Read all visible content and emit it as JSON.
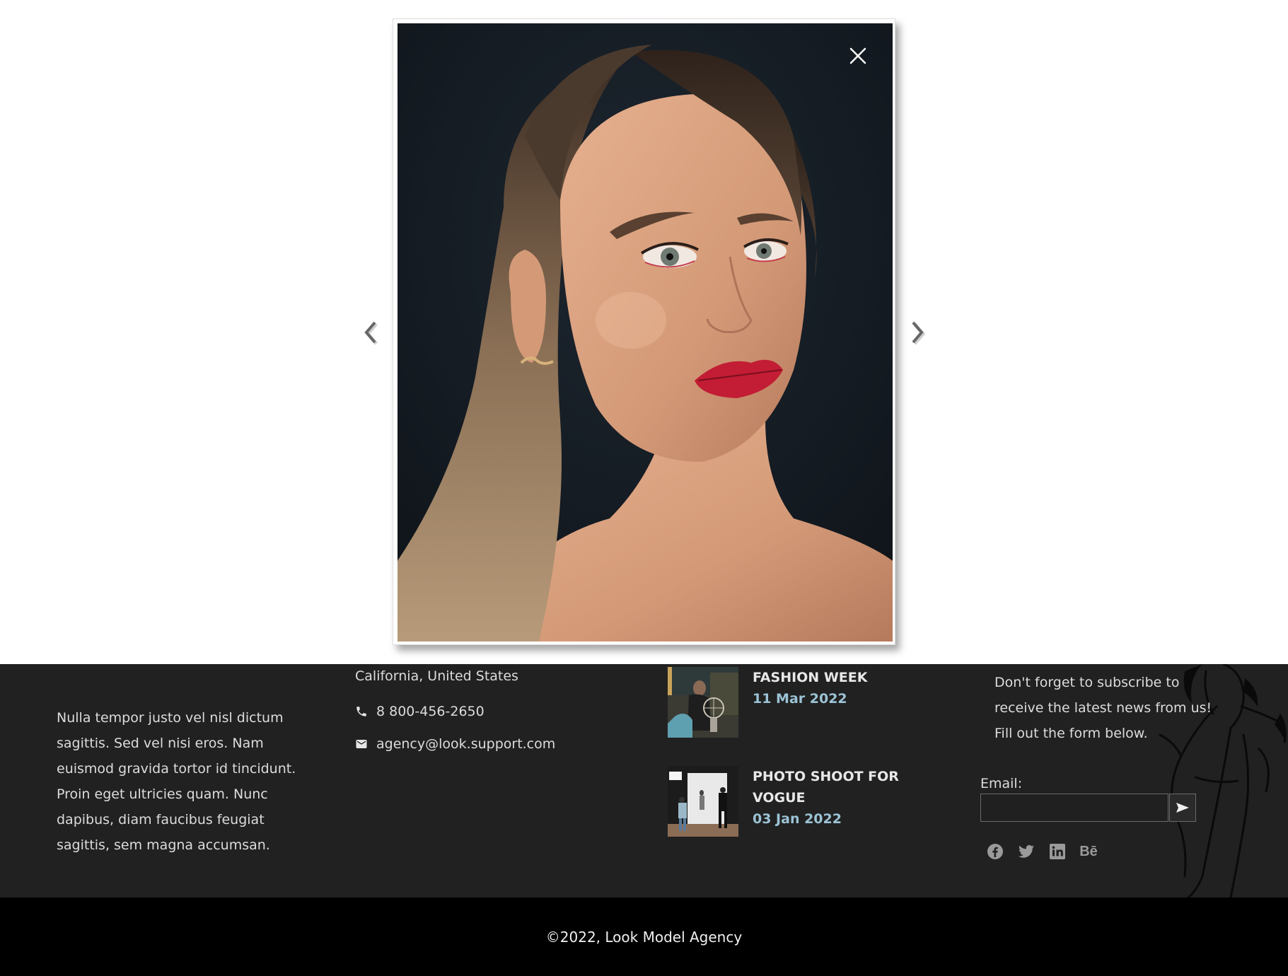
{
  "lightbox": {
    "close_icon": "close-icon",
    "prev_icon": "chevron-left-icon",
    "next_icon": "chevron-right-icon"
  },
  "footer": {
    "about_text": "Nulla tempor justo vel nisl dictum sagittis. Sed vel nisi eros. Nam euismod gravida tortor id tincidunt. Proin eget ultricies quam. Nunc dapibus, diam faucibus feugiat sagittis, sem magna accumsan.",
    "contact": {
      "address_line": "California, United States",
      "phone": "8 800-456-2650",
      "email": "agency@look.support.com",
      "phone_icon": "phone-icon",
      "email_icon": "mail-icon"
    },
    "news": [
      {
        "title": "FASHION WEEK",
        "date": "11 Mar 2022"
      },
      {
        "title": "PHOTO SHOOT FOR VOGUE",
        "date": "03 Jan 2022"
      }
    ],
    "subscribe": {
      "text": "Don't forget to subscribe to receive the latest news from us! Fill out the form below.",
      "email_label": "Email:",
      "email_value": "",
      "submit_icon": "send-icon"
    },
    "socials": [
      "facebook-icon",
      "twitter-icon",
      "linkedin-icon",
      "behance-icon"
    ],
    "behance_label": "Bē",
    "copyright": "©2022, Look Model Agency"
  },
  "colors": {
    "footer_bg": "#212121",
    "footer_bottom_bg": "#000000",
    "news_date": "#9cc3d5",
    "page_bg": "#ffffff"
  }
}
